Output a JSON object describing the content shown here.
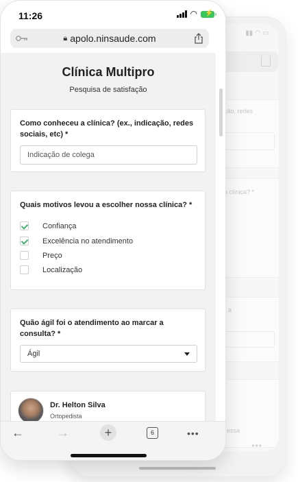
{
  "status_bar": {
    "time": "11:26"
  },
  "browser": {
    "url": "apolo.ninsaude.com",
    "open_tabs": "6"
  },
  "page": {
    "title": "Clínica Multipro",
    "subtitle": "Pesquisa de satisfação"
  },
  "questions": {
    "q1": {
      "label": "Como conheceu a clínica? (ex., indicação, redes sociais, etc) *",
      "value": "Indicação de colega"
    },
    "q2": {
      "label": "Quais motivos levou a escolher nossa clínica? *",
      "options": [
        {
          "label": "Confiança",
          "checked": true
        },
        {
          "label": "Excelência no atendimento",
          "checked": true
        },
        {
          "label": "Preço",
          "checked": false
        },
        {
          "label": "Localização",
          "checked": false
        }
      ]
    },
    "q3": {
      "label": "Quão ágil foi o atendimento ao marcar a consulta? *",
      "selected": "Ágil"
    }
  },
  "doctor": {
    "name": "Dr. Helton Silva",
    "specialty": "Ortopedista"
  },
  "back_phone": {
    "snippet_1": "ção, redes",
    "snippet_2": "a clínica? *",
    "snippet_3": "a",
    "snippet_4": "essa"
  },
  "colors": {
    "accent_check": "#39b56a",
    "battery": "#34c759",
    "page_bg": "#f2f2f2"
  },
  "icons": {
    "key": "key-icon",
    "lock": "lock-icon",
    "share": "share-icon",
    "back": "arrow-left-icon",
    "forward": "arrow-right-icon",
    "new_tab": "plus-icon",
    "tabs": "tabs-icon",
    "more": "more-icon"
  }
}
